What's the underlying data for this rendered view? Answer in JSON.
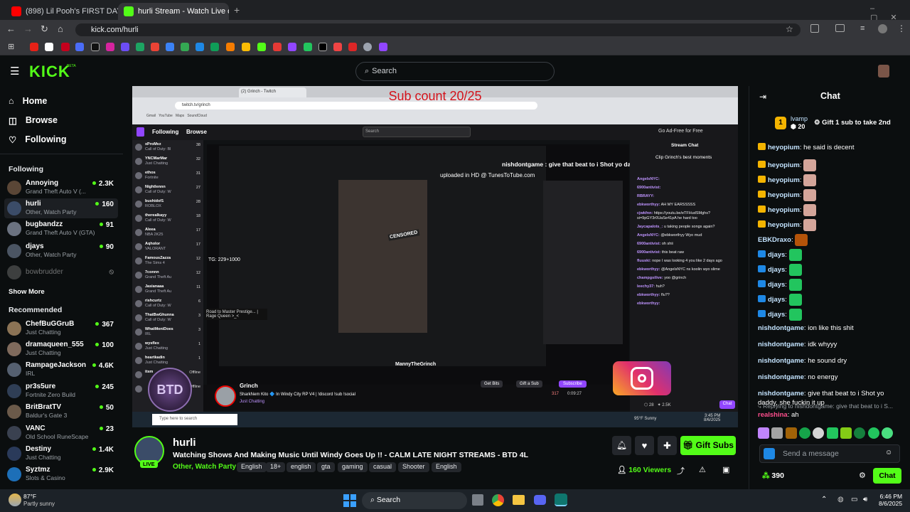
{
  "browser": {
    "tabs": [
      {
        "label": "(898) Lil Pooh's FIRST DAY on W"
      },
      {
        "label": "hurli Stream - Watch Live o"
      }
    ],
    "url": "kick.com/hurli"
  },
  "header": {
    "logo": "KICK",
    "beta": "BETA",
    "search_placeholder": "Search"
  },
  "sidebar": {
    "nav": [
      {
        "label": "Home",
        "icon": "home-icon"
      },
      {
        "label": "Browse",
        "icon": "compass-icon"
      },
      {
        "label": "Following",
        "icon": "heart-icon"
      }
    ],
    "following_title": "Following",
    "following": [
      {
        "name": "Annoying",
        "sub": "Grand Theft Auto V (...",
        "viewers": "2.3K"
      },
      {
        "name": "hurli",
        "sub": "Other, Watch Party",
        "viewers": "160"
      },
      {
        "name": "bugbandzz",
        "sub": "Grand Theft Auto V (GTA)",
        "viewers": "91"
      },
      {
        "name": "djays",
        "sub": "Other, Watch Party",
        "viewers": "90"
      },
      {
        "name": "bowbrudder",
        "sub": "",
        "viewers": ""
      }
    ],
    "show_more": "Show More",
    "recommended_title": "Recommended",
    "recommended": [
      {
        "name": "ChefBuGGruB",
        "sub": "Just Chatting",
        "viewers": "367"
      },
      {
        "name": "dramaqueen_555",
        "sub": "Just Chatting",
        "viewers": "100"
      },
      {
        "name": "RampageJackson",
        "sub": "IRL",
        "viewers": "4.6K"
      },
      {
        "name": "pr3s5ure",
        "sub": "Fortnite Zero Build",
        "viewers": "245"
      },
      {
        "name": "BritBratTV",
        "sub": "Baldur's Gate 3",
        "viewers": "50"
      },
      {
        "name": "VANC",
        "sub": "Old School RuneScape",
        "viewers": "23"
      },
      {
        "name": "Destiny",
        "sub": "Just Chatting",
        "viewers": "1.4K"
      },
      {
        "name": "Syztmz",
        "sub": "Slots & Casino",
        "viewers": "2.9K"
      }
    ]
  },
  "video": {
    "overlay_title": "Sub count 20/25",
    "inner_url": "twitch.tv/grinch",
    "inner_nav": [
      "Following",
      "Browse"
    ],
    "inner_search": "Search",
    "stream_chat_title": "Stream Chat",
    "clip_title": "Clip Grinch's best moments",
    "highlight_msg": "nishdontgame : give that beat to i Shot yo daddy, she fuckin it up",
    "uploaded": "uploaded in HD @ TunesToTube.com",
    "tg": "TG: 229+1000",
    "censored": "CENSORED",
    "road": "Road to Master Prestige... | Rage Queen >_<",
    "mannyname": "MannyTheGrinch",
    "streamer": "Grinch",
    "stream_title": "SharkNem Kito 🔷 In Windy City RP V4 | !discord !sub !social",
    "stream_cat": "Just Chatting",
    "get_bits": "Get Bits",
    "gift_sub": "Gift a Sub",
    "subscribe": "Subscribe",
    "viewers": "317",
    "uptime": "0:09:27",
    "taskbar_search": "Type here to search",
    "weather": "95°F Sunny",
    "time": "3:45 PM",
    "date": "8/6/2025",
    "inner_following": [
      {
        "n": "xProMvz",
        "g": "Call of Duty: Bl",
        "v": "38"
      },
      {
        "n": "YNCMarMar",
        "g": "Just Chatting",
        "v": "32"
      },
      {
        "n": "ethos",
        "g": "Fortnite",
        "v": "31"
      },
      {
        "n": "Nightlennn",
        "g": "Call of Duty: W",
        "v": "27"
      },
      {
        "n": "bushidof1",
        "g": "ROBLOX",
        "v": "28"
      },
      {
        "n": "therealkayy",
        "g": "Call of Duty: W",
        "v": "18"
      },
      {
        "n": "Aleea",
        "g": "NBA 2K25",
        "v": "17"
      },
      {
        "n": "Aqholor",
        "g": "VALORANT",
        "v": "17"
      },
      {
        "n": "FamousZazza",
        "g": "The Sims 4",
        "v": "12"
      },
      {
        "n": "7connn",
        "g": "Grand Theft Au",
        "v": "12"
      },
      {
        "n": "Jasianaaa",
        "g": "Grand Theft Au",
        "v": "11"
      },
      {
        "n": "rishcurtz",
        "g": "Call of Duty: W",
        "v": "6"
      },
      {
        "n": "ThatBwGhunna",
        "g": "Call of Duty: W",
        "v": "3"
      },
      {
        "n": "WhatMoniDoes",
        "g": "IRL",
        "v": "3"
      },
      {
        "n": "wysflex",
        "g": "Just Chatting",
        "v": "1"
      },
      {
        "n": "heartkadin",
        "g": "Just Chatting",
        "v": "1"
      },
      {
        "n": "itsm",
        "g": "",
        "v": "Offline"
      },
      {
        "n": "",
        "g": "",
        "v": "Offline"
      }
    ],
    "inner_chat": [
      {
        "u": "AngelsNYC:",
        "t": ""
      },
      {
        "u": "6900antivist:",
        "t": ""
      },
      {
        "u": "RBRAYY:",
        "t": ""
      },
      {
        "u": "ebkworthyy:",
        "t": "AH MY EARSSSSS"
      },
      {
        "u": "cjwkfnn:",
        "t": "https://youtu.be/eTFHudSMghs?si=9pGY3r0UaSe41pA he hard too"
      },
      {
        "u": "Jaycapalots_:",
        "t": "u taking people songs again?"
      },
      {
        "u": "AngelsNYC:",
        "t": "@ebkworthyy Wyo mud"
      },
      {
        "u": "6900antivist:",
        "t": "oh shii"
      },
      {
        "u": "6900antivist:",
        "t": "this beat raw"
      },
      {
        "u": "fluuski:",
        "t": "nope I was looking 4 you like 2 days ago"
      },
      {
        "u": "ebkworthyy:",
        "t": "@AngelsNYC ns koolin wyo slime"
      },
      {
        "u": "champgsilive:",
        "t": "yoo @grinch"
      },
      {
        "u": "leechy37:",
        "t": "huh?"
      },
      {
        "u": "ebkworthyy:",
        "t": "flu??"
      },
      {
        "u": "ebkworthyy:",
        "t": ""
      }
    ],
    "inner_chat_count": "28",
    "inner_chat_pts": "2.5K",
    "inner_chat_btn": "Chat"
  },
  "stream": {
    "name": "hurli",
    "title": "Watching Shows And Making Music Until Windy Goes Up !! - CALM LATE NIGHT STREAMS - BTD 4L",
    "category": "Other, Watch Party",
    "tags": [
      "English",
      "18+",
      "english",
      "gta",
      "gaming",
      "casual",
      "Shooter",
      "English"
    ],
    "viewers": "160 Viewers",
    "live": "LIVE",
    "gift_subs": "Gift Subs"
  },
  "chat": {
    "title": "Chat",
    "pinned_user": "lvamp",
    "pinned_count": "20",
    "pinned_text": "Gift 1 sub to take 2nd",
    "messages": [
      {
        "u": "heyopium",
        "t": "he said is decent"
      },
      {
        "u": "heyopium",
        "t": ""
      },
      {
        "u": "heyopium",
        "t": ""
      },
      {
        "u": "heyopium",
        "t": ""
      },
      {
        "u": "heyopium",
        "t": ""
      },
      {
        "u": "heyopium",
        "t": ""
      },
      {
        "u": "EBKDraxo",
        "t": ""
      },
      {
        "u": "djays",
        "t": ""
      },
      {
        "u": "djays",
        "t": ""
      },
      {
        "u": "djays",
        "t": ""
      },
      {
        "u": "djays",
        "t": ""
      },
      {
        "u": "djays",
        "t": ""
      },
      {
        "u": "nishdontgame",
        "t": "ion like this shit"
      },
      {
        "u": "nishdontgame",
        "t": "idk whyyy"
      },
      {
        "u": "nishdontgame",
        "t": "he sound dry"
      },
      {
        "u": "nishdontgame",
        "t": "no energy"
      },
      {
        "u": "nishdontgame",
        "t": "give that beat to i Shot yo daddy, she fuckin it up"
      }
    ],
    "reply_label": "Replying to nishdontgame: give that beat to i S...",
    "reply_user": "realshina",
    "reply_text": "ah",
    "input_placeholder": "Send a message",
    "points": "390",
    "chat_button": "Chat"
  },
  "taskbar": {
    "weather_temp": "87°F",
    "weather_desc": "Partly sunny",
    "search": "Search",
    "time": "6:46 PM",
    "date": "8/6/2025"
  }
}
